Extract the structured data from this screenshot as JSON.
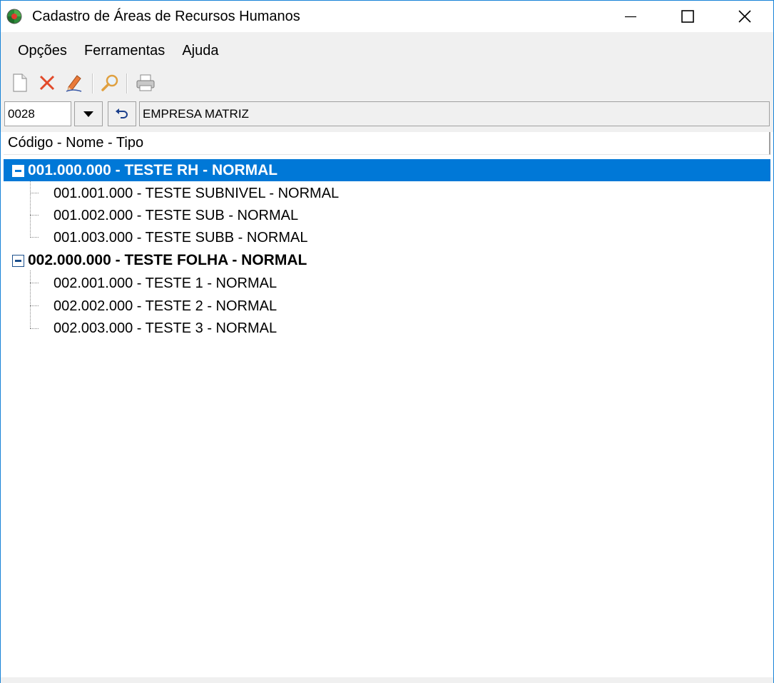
{
  "window": {
    "title": "Cadastro de Áreas de Recursos Humanos"
  },
  "menu": {
    "items": [
      "Opções",
      "Ferramentas",
      "Ajuda"
    ]
  },
  "toolbar": {
    "icons": [
      "new-document-icon",
      "delete-icon",
      "edit-pencil-icon",
      "search-magnifier-icon",
      "print-icon"
    ]
  },
  "company": {
    "code": "0028",
    "name": "EMPRESA MATRIZ"
  },
  "tree": {
    "column_header": "Código - Nome - Tipo",
    "groups": [
      {
        "label": "001.000.000 - TESTE RH - NORMAL",
        "selected": true,
        "children": [
          "001.001.000 - TESTE SUBNIVEL - NORMAL",
          "001.002.000 - TESTE SUB - NORMAL",
          "001.003.000 - TESTE SUBB - NORMAL"
        ]
      },
      {
        "label": "002.000.000 - TESTE FOLHA - NORMAL",
        "selected": false,
        "children": [
          "002.001.000 - TESTE 1 - NORMAL",
          "002.002.000 - TESTE 2 - NORMAL",
          "002.003.000 - TESTE 3 - NORMAL"
        ]
      }
    ]
  },
  "colors": {
    "selection": "#0078d7",
    "window_border": "#1883d7",
    "chrome_bg": "#f0f0f0"
  }
}
